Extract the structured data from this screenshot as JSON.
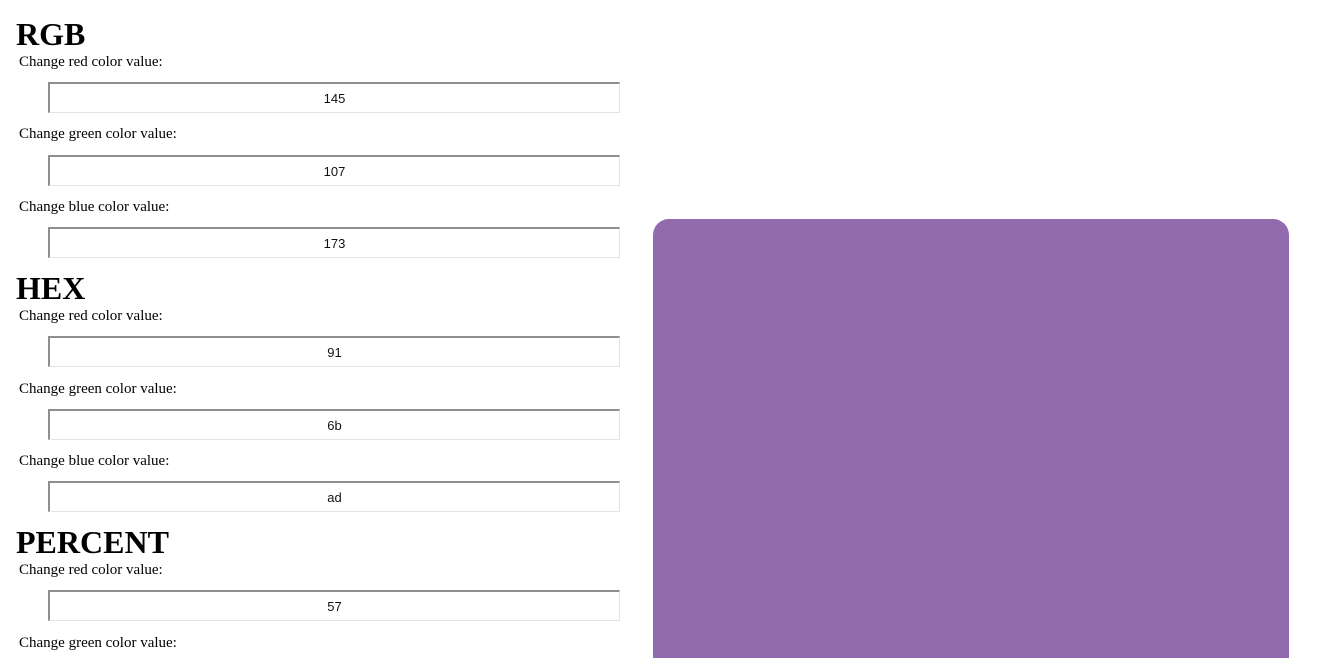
{
  "rgb": {
    "title": "RGB",
    "red_label": "Change red color value:",
    "red_value": "145",
    "green_label": "Change green color value:",
    "green_value": "107",
    "blue_label": "Change blue color value:",
    "blue_value": "173"
  },
  "hex": {
    "title": "HEX",
    "red_label": "Change red color value:",
    "red_value": "91",
    "green_label": "Change green color value:",
    "green_value": "6b",
    "blue_label": "Change blue color value:",
    "blue_value": "ad"
  },
  "percent": {
    "title": "PERCENT",
    "red_label": "Change red color value:",
    "red_value": "57",
    "green_label": "Change green color value:"
  },
  "preview": {
    "color": "#916bad"
  }
}
